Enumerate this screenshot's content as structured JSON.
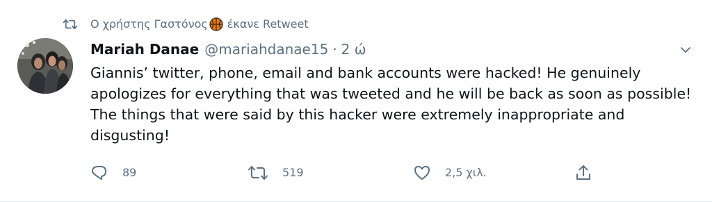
{
  "retweet": {
    "prefix": "Ο χρήστης Γαστόνος",
    "suffix": "έκανε Retweet"
  },
  "author": {
    "name": "Mariah Danae",
    "handle": "@mariahdanae15",
    "separator": "·",
    "time": "2 ώ"
  },
  "tweet_text": "Giannis’ twitter, phone, email and bank accounts were hacked! He genuinely apologizes for everything that was tweeted and he will be back as soon as possible! The things that were said by this hacker were extremely inappropriate and disgusting!",
  "actions": {
    "replies": "89",
    "retweets": "519",
    "likes": "2,5 χιλ."
  },
  "colors": {
    "muted": "#5b7083",
    "text": "#0f1419",
    "basketball": "#e37a17"
  }
}
